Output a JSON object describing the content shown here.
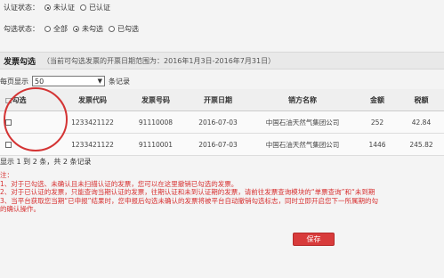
{
  "filters": {
    "auth_label": "认证状态：",
    "auth_options": [
      "未认证",
      "已认证"
    ],
    "auth_selected": 0,
    "check_label": "勾选状态：",
    "check_options": [
      "全部",
      "未勾选",
      "已勾选"
    ],
    "check_selected": 1
  },
  "section": {
    "title": "发票勾选",
    "hint": "（当前可勾选发票的开票日期范围为：2016年1月3日-2016年7月31日）"
  },
  "pagesize": {
    "prefix": "每页显示",
    "value": "50",
    "suffix": "条记录"
  },
  "table": {
    "columns": [
      "□勾选",
      "发票代码",
      "发票号码",
      "开票日期",
      "销方名称",
      "金额",
      "税额"
    ],
    "rows": [
      [
        "1233421122",
        "91110008",
        "2016-07-03",
        "中国石油天然气集团公司",
        "252",
        "42.84"
      ],
      [
        "1233421122",
        "91110001",
        "2016-07-03",
        "中国石油天然气集团公司",
        "1446",
        "245.82"
      ]
    ]
  },
  "summary": "显示 1 到 2 条，共 2 条记录",
  "notes": {
    "title": "注：",
    "lines": [
      "1、对于已勾选、未确认且未扫描认证的发票，您可以在这里撤销已勾选的发票。",
      "2、对于已认证的发票，只能查询当期认证的发票，往期认证和未到认证期的发票，请前往发票查询模块的“单票查询”和“未到期",
      "3、当平台获取您当期“已申报”结果时，您申报后勾选未确认的发票将被平台自动撤销勾选标志，同时立即开启您下一所属期的勾",
      "的确认操作。"
    ]
  },
  "save_label": "保存"
}
